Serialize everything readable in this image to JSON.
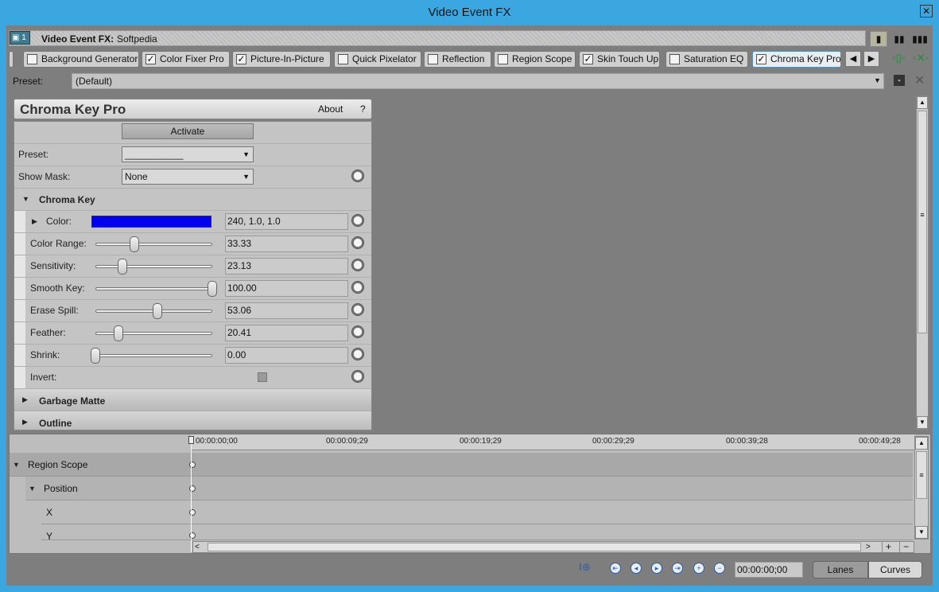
{
  "window": {
    "title": "Video Event FX",
    "close_glyph": "✕"
  },
  "header": {
    "badge": "1",
    "title": "Video Event FX:",
    "name": "Softpedia"
  },
  "fx_chain": {
    "tabs": [
      {
        "label": "Background Generator",
        "checked": false
      },
      {
        "label": "Color Fixer Pro",
        "checked": true
      },
      {
        "label": "Picture-In-Picture",
        "checked": true
      },
      {
        "label": "Quick Pixelator",
        "checked": false
      },
      {
        "label": "Reflection",
        "checked": false
      },
      {
        "label": "Region Scope",
        "checked": false
      },
      {
        "label": "Skin Touch Up",
        "checked": true
      },
      {
        "label": "Saturation EQ",
        "checked": false
      },
      {
        "label": "Chroma Key Pro",
        "checked": true,
        "active": true
      }
    ]
  },
  "preset_bar": {
    "label": "Preset:",
    "value": "(Default)"
  },
  "plugin": {
    "title": "Chroma Key Pro",
    "about": "About",
    "help": "?",
    "activate": "Activate",
    "preset_label": "Preset:",
    "preset_value": "___________",
    "show_mask_label": "Show Mask:",
    "show_mask_value": "None",
    "section_chroma": "Chroma Key",
    "color_label": "Color:",
    "color_swatch": "#0000ee",
    "color_value": "240, 1.0, 1.0",
    "sliders": [
      {
        "label": "Color Range:",
        "value": "33.33",
        "fraction": 0.33
      },
      {
        "label": "Sensitivity:",
        "value": "23.13",
        "fraction": 0.23
      },
      {
        "label": "Smooth Key:",
        "value": "100.00",
        "fraction": 1.0
      },
      {
        "label": "Erase Spill:",
        "value": "53.06",
        "fraction": 0.53
      },
      {
        "label": "Feather:",
        "value": "20.41",
        "fraction": 0.2
      },
      {
        "label": "Shrink:",
        "value": "0.00",
        "fraction": 0.0
      }
    ],
    "invert_label": "Invert:",
    "section_garbage": "Garbage Matte",
    "section_outline": "Outline"
  },
  "timeline": {
    "ticks": [
      "00:00:00;00",
      "00:00:09;29",
      "00:00:19;29",
      "00:00:29;29",
      "00:00:39;28",
      "00:00:49;28"
    ],
    "rows": [
      "Region Scope",
      "Position",
      "X",
      "Y"
    ]
  },
  "bottom": {
    "timecode": "00:00:00;00",
    "lanes": "Lanes",
    "curves": "Curves"
  }
}
